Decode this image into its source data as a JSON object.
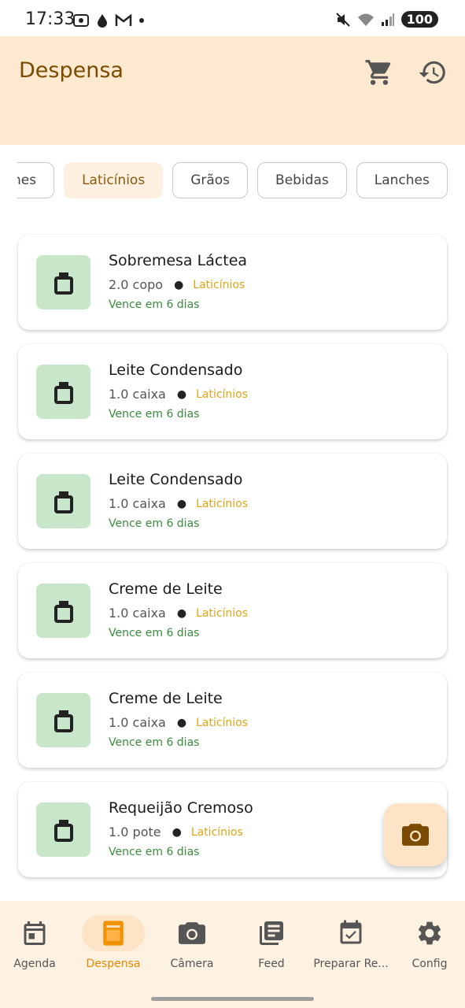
{
  "status_bar": {
    "time": "17:33",
    "battery": "100"
  },
  "header": {
    "title": "Despensa"
  },
  "chips": [
    {
      "label": "Carnes",
      "active": false
    },
    {
      "label": "Laticínios",
      "active": true
    },
    {
      "label": "Grãos",
      "active": false
    },
    {
      "label": "Bebidas",
      "active": false
    },
    {
      "label": "Lanches",
      "active": false
    }
  ],
  "items": [
    {
      "name": "Sobremesa Láctea",
      "quantity": "2.0 copo",
      "category": "Laticínios",
      "expiry": "Vence em 6 dias"
    },
    {
      "name": "Leite Condensado",
      "quantity": "1.0 caixa",
      "category": "Laticínios",
      "expiry": "Vence em 6 dias"
    },
    {
      "name": "Leite Condensado",
      "quantity": "1.0 caixa",
      "category": "Laticínios",
      "expiry": "Vence em 6 dias"
    },
    {
      "name": "Creme de Leite",
      "quantity": "1.0 caixa",
      "category": "Laticínios",
      "expiry": "Vence em 6 dias"
    },
    {
      "name": "Creme de Leite",
      "quantity": "1.0 caixa",
      "category": "Laticínios",
      "expiry": "Vence em 6 dias"
    },
    {
      "name": "Requeijão Cremoso",
      "quantity": "1.0 pote",
      "category": "Laticínios",
      "expiry": "Vence em 6 dias"
    }
  ],
  "bottom_nav": [
    {
      "label": "Agenda",
      "icon": "calendar-icon",
      "active": false
    },
    {
      "label": "Despensa",
      "icon": "pantry-icon",
      "active": true
    },
    {
      "label": "Câmera",
      "icon": "camera-icon",
      "active": false
    },
    {
      "label": "Feed",
      "icon": "feed-icon",
      "active": false
    },
    {
      "label": "Preparar Re...",
      "icon": "calendar-check-icon",
      "active": false
    },
    {
      "label": "Config",
      "icon": "gear-icon",
      "active": false
    }
  ],
  "colors": {
    "header_bg": "#fde9cf",
    "title": "#7a4a00",
    "category": "#e0a417",
    "expiry": "#3b8a3e",
    "thumb_bg": "#c8e6c9",
    "nav_active": "#e58a00"
  }
}
